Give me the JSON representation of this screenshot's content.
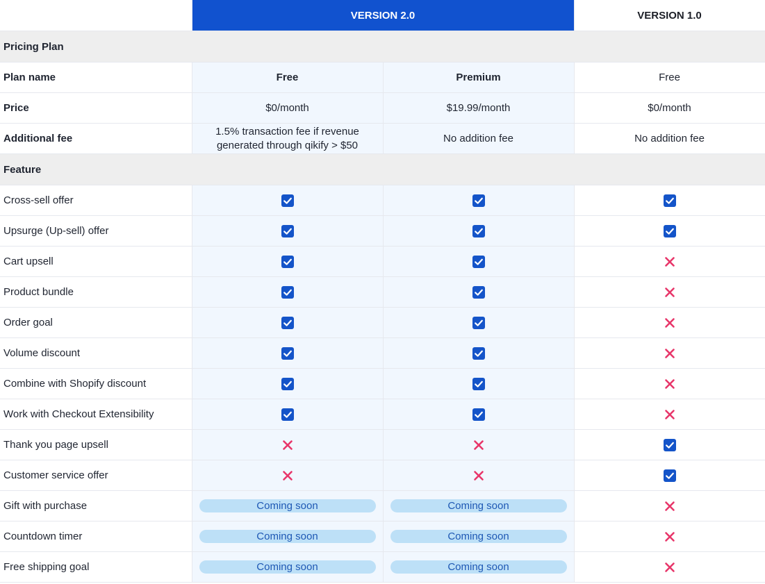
{
  "header": {
    "version2_label": "VERSION 2.0",
    "version1_label": "VERSION 1.0"
  },
  "colors": {
    "accent": "#1152cf",
    "check": "#1454c9",
    "cross": "#e8366a",
    "coming_soon_bg": "#bde0f7"
  },
  "sections": {
    "pricing": "Pricing Plan",
    "feature": "Feature"
  },
  "pricing_rows": [
    {
      "label": "Plan name",
      "free": "Free",
      "premium": "Premium",
      "v1": "Free"
    },
    {
      "label": "Price",
      "free": "$0/month",
      "premium": "$19.99/month",
      "v1": "$0/month"
    },
    {
      "label": "Additional fee",
      "free_line1": "1.5% transaction fee if revenue",
      "free_line2": "generated through qikify > $50",
      "premium": "No addition fee",
      "v1": "No addition fee"
    }
  ],
  "coming_soon_label": "Coming soon",
  "features": [
    {
      "label": "Cross-sell offer",
      "free": "check",
      "premium": "check",
      "v1": "check"
    },
    {
      "label": "Upsurge (Up-sell) offer",
      "free": "check",
      "premium": "check",
      "v1": "check"
    },
    {
      "label": "Cart upsell",
      "free": "check",
      "premium": "check",
      "v1": "cross"
    },
    {
      "label": "Product bundle",
      "free": "check",
      "premium": "check",
      "v1": "cross"
    },
    {
      "label": "Order goal",
      "free": "check",
      "premium": "check",
      "v1": "cross"
    },
    {
      "label": "Volume discount",
      "free": "check",
      "premium": "check",
      "v1": "cross"
    },
    {
      "label": "Combine with Shopify discount",
      "free": "check",
      "premium": "check",
      "v1": "cross"
    },
    {
      "label": "Work with Checkout Extensibility",
      "free": "check",
      "premium": "check",
      "v1": "cross"
    },
    {
      "label": "Thank you page upsell",
      "free": "cross",
      "premium": "cross",
      "v1": "check"
    },
    {
      "label": "Customer service offer",
      "free": "cross",
      "premium": "cross",
      "v1": "check"
    },
    {
      "label": "Gift with purchase",
      "free": "soon",
      "premium": "soon",
      "v1": "cross"
    },
    {
      "label": "Countdown timer",
      "free": "soon",
      "premium": "soon",
      "v1": "cross"
    },
    {
      "label": "Free shipping goal",
      "free": "soon",
      "premium": "soon",
      "v1": "cross"
    }
  ]
}
